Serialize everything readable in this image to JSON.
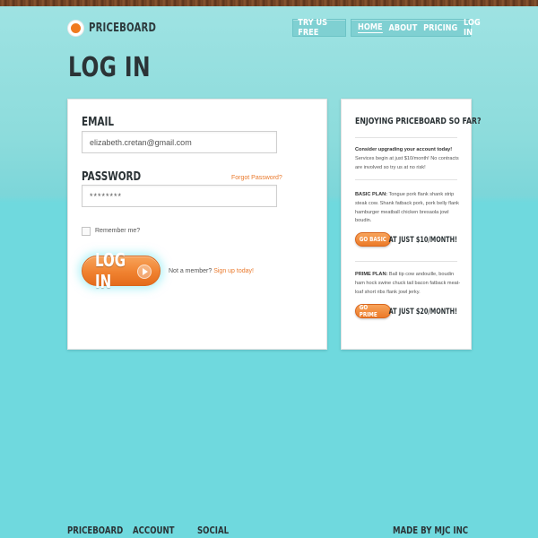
{
  "brand": {
    "name": "PRICEBOARD",
    "logo_color": "#f07a1f"
  },
  "header": {
    "try_button": "TRY US FREE",
    "nav": [
      "HOME",
      "ABOUT",
      "PRICING",
      "LOG IN"
    ],
    "active_nav": "HOME"
  },
  "page_title": "LOG IN",
  "login_form": {
    "email_label": "EMAIL",
    "email_value": "elizabeth.cretan@gmail.com",
    "password_label": "PASSWORD",
    "password_value": "********",
    "forgot_link": "Forgot Password?",
    "remember_label": "Remember me?",
    "remember_checked": false,
    "submit_label": "LOG IN",
    "not_member_text": "Not a member?",
    "signup_link": "Sign up today!"
  },
  "sidebar": {
    "title": "ENJOYING PRICEBOARD SO FAR?",
    "upgrade_heading": "Consider upgrading your account today!",
    "upgrade_text": "Services begin at just $10/month! No contracts are involved so try us at no risk!",
    "basic_heading": "BASIC PLAN:",
    "basic_text": "Tongue pork flank shank strip steak cow. Shank fatback pork, pork belly flank hamburger meatball chicken bresaola jowl boudin.",
    "basic_button": "GO BASIC",
    "basic_price": "AT JUST $10/MONTH!",
    "prime_heading": "PRIME PLAN:",
    "prime_text": "Ball tip cow andouille, boudin ham hock swine chuck tail bacon fatback meat-loaf short ribs flank jowl jerky.",
    "prime_button": "GO PRIME",
    "prime_price": "AT JUST $20/MONTH!"
  },
  "footer": {
    "columns": [
      "PRICEBOARD",
      "ACCOUNT",
      "SOCIAL"
    ],
    "credit": "MADE BY MJC INC"
  },
  "colors": {
    "accent": "#f07a1f",
    "background": "#6fd9de",
    "text": "#2b3336"
  }
}
